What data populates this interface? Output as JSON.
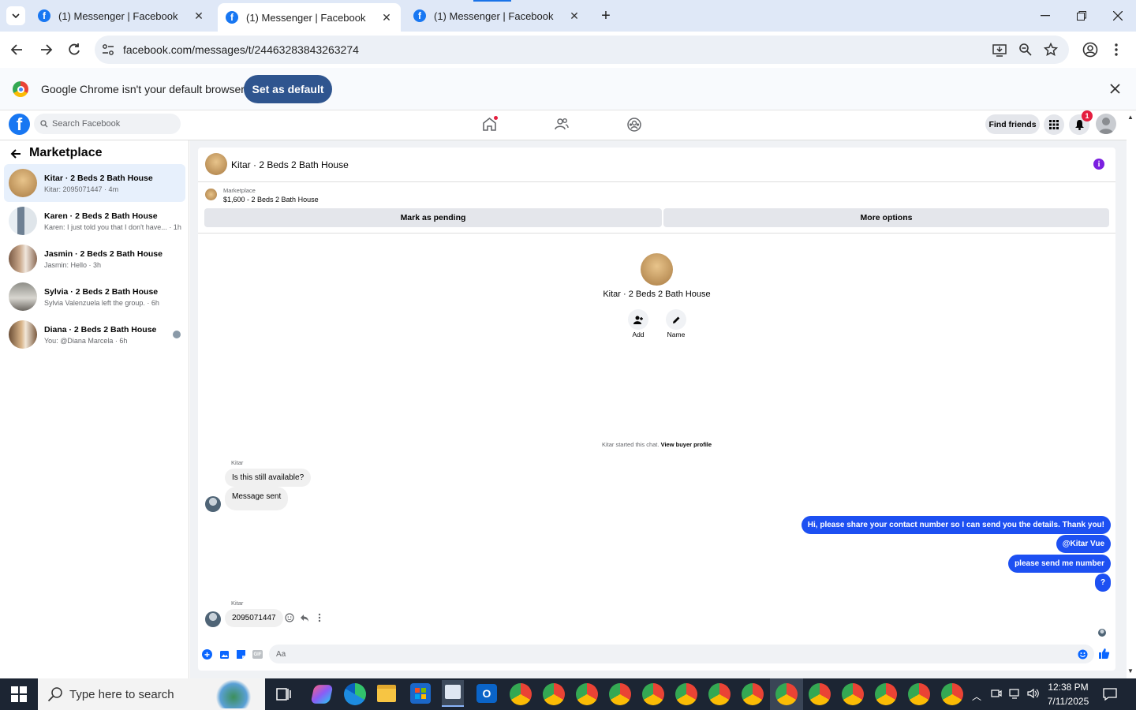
{
  "browser": {
    "tabs": [
      {
        "title": "(1) Messenger | Facebook"
      },
      {
        "title": "(1) Messenger | Facebook"
      },
      {
        "title": "(1) Messenger | Facebook"
      }
    ],
    "url": "facebook.com/messages/t/24463283843263274",
    "infobar_text": "Google Chrome isn't your default browser",
    "infobar_button": "Set as default"
  },
  "fb": {
    "search_placeholder": "Search Facebook",
    "find_friends": "Find friends",
    "notif_count": "1"
  },
  "sidebar": {
    "title": "Marketplace",
    "conversations": [
      {
        "name": "Kitar · 2 Beds 2 Bath House",
        "preview": "Kitar: 2095071447 · 4m",
        "color": "#c89a5a"
      },
      {
        "name": "Karen · 2 Beds 2 Bath House",
        "preview": "Karen: I just told you that I don't have...  · 1h",
        "color": "#8fa3b8"
      },
      {
        "name": "Jasmin · 2 Beds 2 Bath House",
        "preview": "Jasmin: Hello · 3h",
        "color": "#a47e63"
      },
      {
        "name": "Sylvia · 2 Beds 2 Bath House",
        "preview": "Sylvia Valenzuela left the group. · 6h",
        "color": "#9b9b95"
      },
      {
        "name": "Diana · 2 Beds 2 Bath House",
        "preview": "You: @Diana Marcela · 6h",
        "color": "#b08a62"
      }
    ]
  },
  "chat": {
    "title": "Kitar · 2 Beds 2 Bath House",
    "listing_source": "Marketplace",
    "listing": "$1,600 - 2 Beds 2 Bath House",
    "mark_pending": "Mark as pending",
    "more_options": "More options",
    "group_name": "Kitar · 2 Beds 2 Bath House",
    "add_label": "Add",
    "name_label": "Name",
    "started_text": "Kitar started this chat.",
    "view_profile": "View buyer profile",
    "sender1": "Kitar",
    "msg1": "Is this still available?",
    "msg2": "Message sent",
    "out1": "Hi, please share your contact number so I can send you the details. Thank you!",
    "out2": "@Kitar Vue",
    "out3": "please send me number",
    "out4": "?",
    "sender2": "Kitar",
    "msg3": "2095071447",
    "composer_placeholder": "Aa"
  },
  "taskbar": {
    "search_placeholder": "Type here to search",
    "time": "12:38 PM",
    "date": "7/11/2025"
  },
  "colors": {
    "fb_blue": "#1877f2",
    "outgoing_bubble": "#1d50f2",
    "selected_conv": "#e7f0fc"
  }
}
